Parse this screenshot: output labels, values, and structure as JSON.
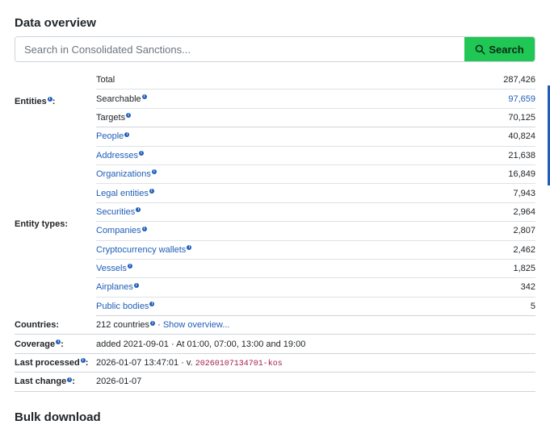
{
  "section_title": "Data overview",
  "search": {
    "placeholder": "Search in Consolidated Sanctions...",
    "button_label": "Search"
  },
  "entities": {
    "label": "Entities",
    "rows": [
      {
        "label": "Total",
        "value": "287,426"
      },
      {
        "label": "Searchable",
        "value": "97,659"
      },
      {
        "label": "Targets",
        "value": "70,125"
      }
    ]
  },
  "entity_types": {
    "label": "Entity types:",
    "rows": [
      {
        "label": "People",
        "value": "40,824"
      },
      {
        "label": "Addresses",
        "value": "21,638"
      },
      {
        "label": "Organizations",
        "value": "16,849"
      },
      {
        "label": "Legal entities",
        "value": "7,943"
      },
      {
        "label": "Securities",
        "value": "2,964"
      },
      {
        "label": "Companies",
        "value": "2,807"
      },
      {
        "label": "Cryptocurrency wallets",
        "value": "2,462"
      },
      {
        "label": "Vessels",
        "value": "1,825"
      },
      {
        "label": "Airplanes",
        "value": "342"
      },
      {
        "label": "Public bodies",
        "value": "5"
      }
    ]
  },
  "countries": {
    "label": "Countries:",
    "value": "212 countries",
    "link": "Show overview..."
  },
  "coverage": {
    "label": "Coverage",
    "value": "added 2021-09-01 · At 01:00, 07:00, 13:00 and 19:00"
  },
  "last_processed": {
    "label": "Last processed",
    "value": "2026-01-07 13:47:01 · v.",
    "version": "20260107134701-kos"
  },
  "last_change": {
    "label": "Last change",
    "value": "2026-01-07"
  },
  "bulk_title": "Bulk download",
  "colors": {
    "accent": "#1f5eb8",
    "search_button": "#20c755",
    "version_text": "#a3214a"
  }
}
